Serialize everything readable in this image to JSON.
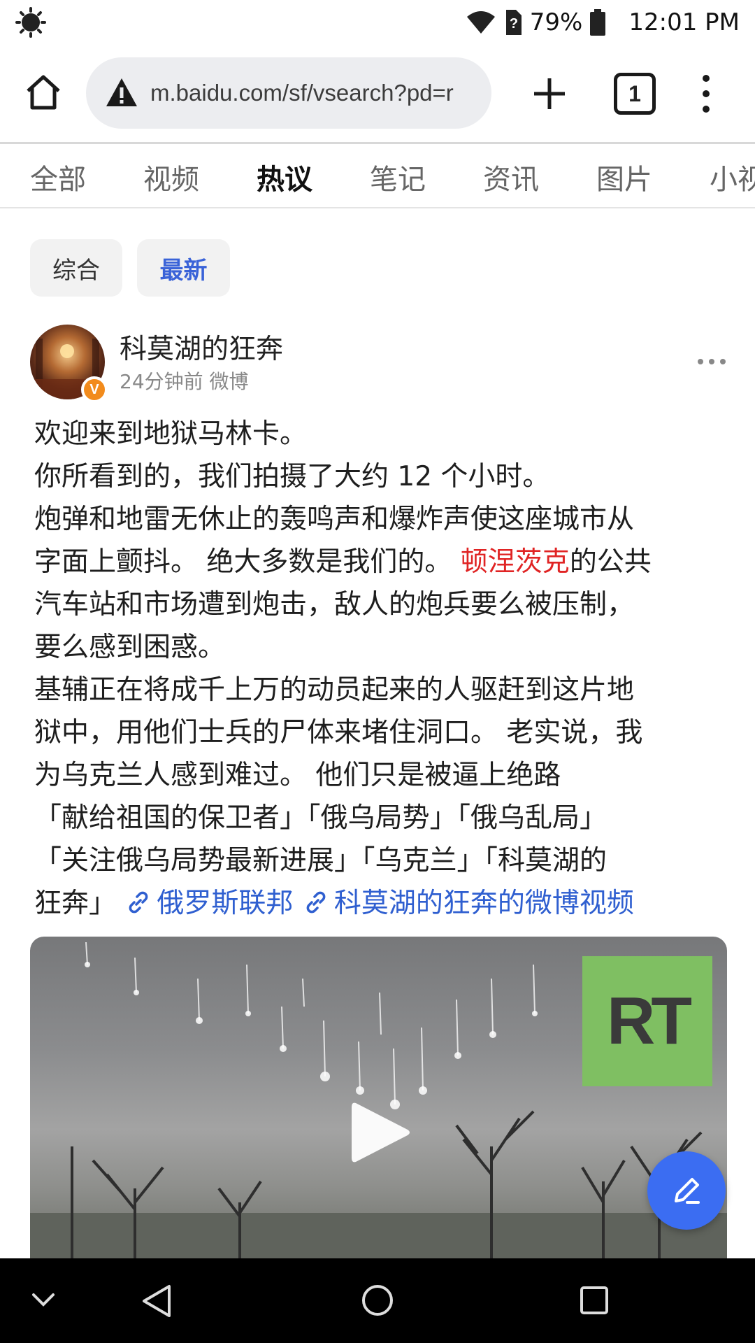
{
  "status_bar": {
    "battery_percent": "79%",
    "time": "12:01 PM",
    "icons": [
      "brightness-icon",
      "wifi-icon",
      "sim-unknown-icon",
      "battery-icon"
    ]
  },
  "browser": {
    "url": "m.baidu.com/sf/vsearch?pd=r",
    "tab_count": "1",
    "icons": [
      "home-icon",
      "warning-icon",
      "plus-icon",
      "tabs-icon",
      "more-vert-icon"
    ]
  },
  "category_tabs": [
    "全部",
    "视频",
    "热议",
    "笔记",
    "资讯",
    "图片",
    "小视"
  ],
  "active_tab": "热议",
  "filters": {
    "all": "综合",
    "latest": "最新",
    "selected": "最新"
  },
  "post": {
    "author": "科莫湖的狂奔",
    "meta": "24分钟前  微博",
    "lines": [
      "欢迎来到地狱马林卡。",
      "你所看到的，我们拍摄了大约 12 个小时。",
      "炮弹和地雷无休止的轰鸣声和爆炸声使这座城市从",
      "字面上颤抖。 绝大多数是我们的。 ",
      "的公共",
      "汽车站和市场遭到炮击，敌人的炮兵要么被压制，",
      "要么感到困惑。",
      "基辅正在将成千上万的动员起来的人驱赶到这片地",
      "狱中，用他们士兵的尸体来堵住洞口。 老实说，我",
      "为乌克兰人感到难过。 他们只是被逼上绝路",
      "「献给祖国的保卫者」「俄乌局势」「俄乌乱局」",
      "「关注俄乌局势最新进展」「乌克兰」「科莫湖的",
      "狂奔」"
    ],
    "place_link": "顿涅茨克",
    "links": [
      "俄罗斯联邦",
      "科莫湖的狂奔的微博视频"
    ],
    "video_watermark": "RT"
  },
  "colors": {
    "accent_blue": "#3a63d8",
    "link_red": "#e02424",
    "fab_blue": "#3b6df2"
  }
}
